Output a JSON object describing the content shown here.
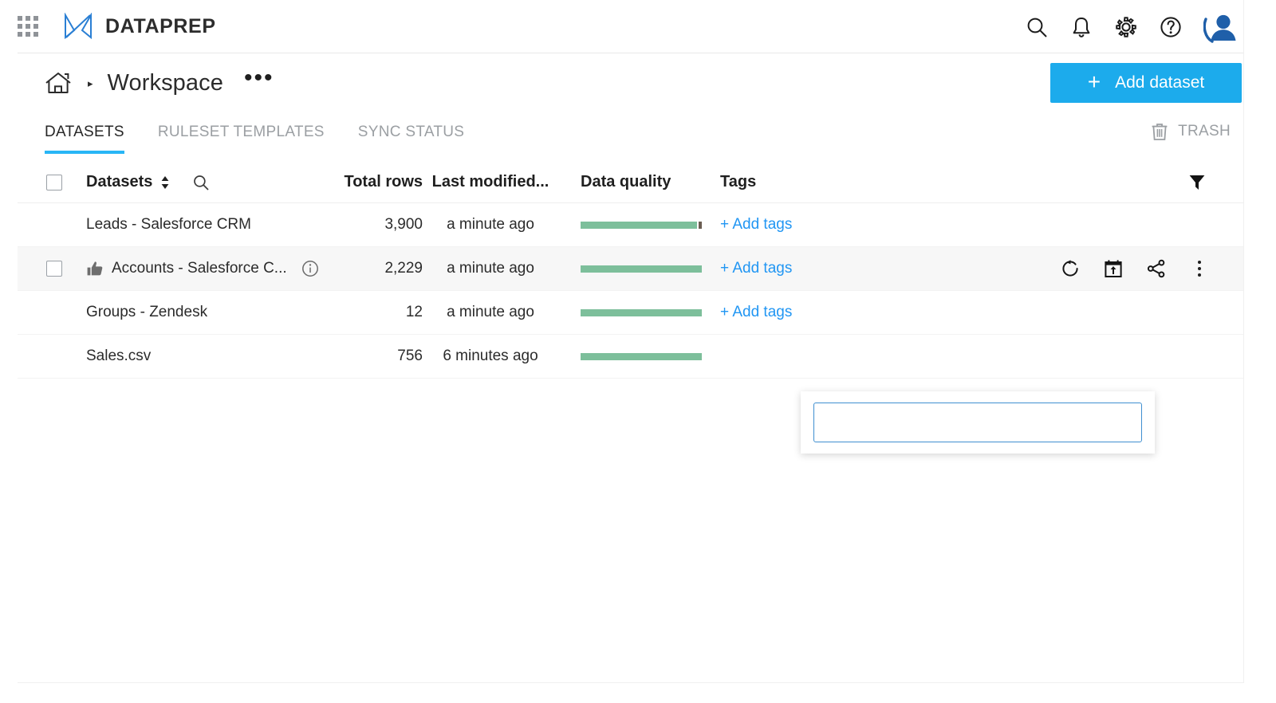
{
  "topbar": {
    "app_grid_icon": "apps-waffle-icon",
    "logo_icon": "dataprep-logo-icon",
    "brand": "DATAPREP",
    "icons": [
      {
        "name": "search-icon",
        "label": "Search"
      },
      {
        "name": "notifications-bell-icon",
        "label": "Notifications"
      },
      {
        "name": "settings-gear-icon",
        "label": "Settings"
      },
      {
        "name": "help-question-icon",
        "label": "Help"
      },
      {
        "name": "user-avatar-icon",
        "label": "Account"
      }
    ]
  },
  "breadcrumb": {
    "home_icon": "home-icon",
    "separator": "▸",
    "title": "Workspace",
    "more": "•••"
  },
  "actions": {
    "add_dataset_label": "Add dataset",
    "add_dataset_plus": "+",
    "add_dataset_color": "#1cabec"
  },
  "tabs": [
    {
      "label": "DATASETS",
      "active": true
    },
    {
      "label": "RULESET TEMPLATES",
      "active": false
    },
    {
      "label": "SYNC STATUS",
      "active": false
    }
  ],
  "trash": {
    "label": "TRASH",
    "icon": "trash-icon"
  },
  "table": {
    "columns": {
      "datasets": "Datasets",
      "total_rows": "Total rows",
      "last_modified": "Last modified...",
      "data_quality": "Data quality",
      "tags": "Tags"
    },
    "header_icons": {
      "sort": "sort-arrows-icon",
      "search": "search-icon",
      "filter": "filter-funnel-icon"
    },
    "add_tags_label": "+ Add tags",
    "rows": [
      {
        "name": "Leads - Salesforce CRM",
        "total_rows": "3,900",
        "last_modified": "a minute ago",
        "quality_percent": 97,
        "quality_color": "#7dbf9b",
        "quality_cap": true,
        "selected": false,
        "checkbox_visible": false,
        "liked": false,
        "info": false,
        "tags": "+ Add tags"
      },
      {
        "name": "Accounts - Salesforce C...",
        "total_rows": "2,229",
        "last_modified": "a minute ago",
        "quality_percent": 100,
        "quality_color": "#7dbf9b",
        "quality_cap": false,
        "selected": true,
        "checkbox_visible": true,
        "liked": true,
        "info": true,
        "tags": "+ Add tags"
      },
      {
        "name": "Groups - Zendesk",
        "total_rows": "12",
        "last_modified": "a minute ago",
        "quality_percent": 100,
        "quality_color": "#7dbf9b",
        "quality_cap": false,
        "selected": false,
        "checkbox_visible": false,
        "liked": false,
        "info": false,
        "tags": "+ Add tags"
      },
      {
        "name": "Sales.csv",
        "total_rows": "756",
        "last_modified": "6 minutes ago",
        "quality_percent": 100,
        "quality_color": "#7dbf9b",
        "quality_cap": false,
        "selected": false,
        "checkbox_visible": false,
        "liked": false,
        "info": false,
        "tags": ""
      }
    ],
    "row_actions": [
      {
        "name": "restore-history-icon",
        "label": "Restore"
      },
      {
        "name": "schedule-calendar-icon",
        "label": "Schedule"
      },
      {
        "name": "share-icon",
        "label": "Share"
      },
      {
        "name": "more-options-kebab-icon",
        "label": "More"
      }
    ]
  },
  "tag_editor": {
    "value": "",
    "placeholder": "",
    "border_color": "#3f8fd0",
    "caret": true
  }
}
